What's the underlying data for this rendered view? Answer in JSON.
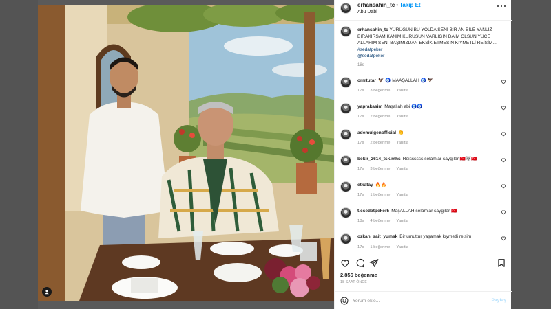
{
  "post": {
    "username": "erhansahin_tc",
    "follow_label": "Takip Et",
    "location": "Abu Dabi",
    "caption_user": "erhansahin_tc",
    "caption_text": "YÜRÜĞÜN BU YOLDA SENİ BİR AN BİLE YANLIZ BIRAKIRSAM KANIM KURUSUN VARLIĞIN DAİM OLSUN YÜCE ALLAHIM SENİ BAŞIMIZDAN EKSİK ETMESİN KIYMETLİ REİSİM...",
    "hashtag": "#sedatpeker",
    "mention": "@sedatpeker",
    "caption_time": "18s"
  },
  "comments": [
    {
      "user": "omrtutar",
      "text": "🦅 🧿 MAAŞALLAH 🧿 🦅",
      "time": "17s",
      "likes": "3 beğenme",
      "reply": "Yanıtla"
    },
    {
      "user": "yaprakasim",
      "text": "Maşallah abi 🧿🧿",
      "time": "17s",
      "likes": "2 beğenme",
      "reply": "Yanıtla"
    },
    {
      "user": "ademulgenofficial",
      "text": "👏",
      "time": "17s",
      "likes": "2 beğenme",
      "reply": "Yanıtla"
    },
    {
      "user": "bekir_2614_tsk.mhs",
      "text": "Reissssss selamlar saygılar 🇹🇷🐺🇹🇷",
      "time": "17s",
      "likes": "3 beğenme",
      "reply": "Yanıtla"
    },
    {
      "user": "etkatay",
      "text": "🔥🔥",
      "time": "17s",
      "likes": "1 beğenme",
      "reply": "Yanıtla"
    },
    {
      "user": "t.csedatpeker5",
      "text": "MaşALLAH selamlar saygılar 🇹🇷",
      "time": "18s",
      "likes": "4 beğenme",
      "reply": "Yanıtla"
    },
    {
      "user": "ozkan_sait_yumak",
      "text": "Bir umuttur yaşamak kıymetli reisim",
      "time": "17s",
      "likes": "1 beğenme",
      "reply": "Yanıtla"
    }
  ],
  "stats": {
    "likes": "2.856 beğenme",
    "ago": "18 SAAT ÖNCE"
  },
  "comment_box": {
    "placeholder": "Yorum ekle...",
    "post_label": "Paylaş"
  },
  "icons": {
    "header_more": "more-horizontal-icon",
    "like": "heart-icon",
    "comment": "comment-icon",
    "share": "share-icon",
    "save": "bookmark-icon",
    "emoji": "emoji-icon",
    "tag": "user-tag-icon"
  },
  "colors": {
    "link_blue": "#0095f6",
    "hashtag": "#00376b",
    "muted": "#8e8e8e",
    "post_disabled": "#b2dffc"
  }
}
